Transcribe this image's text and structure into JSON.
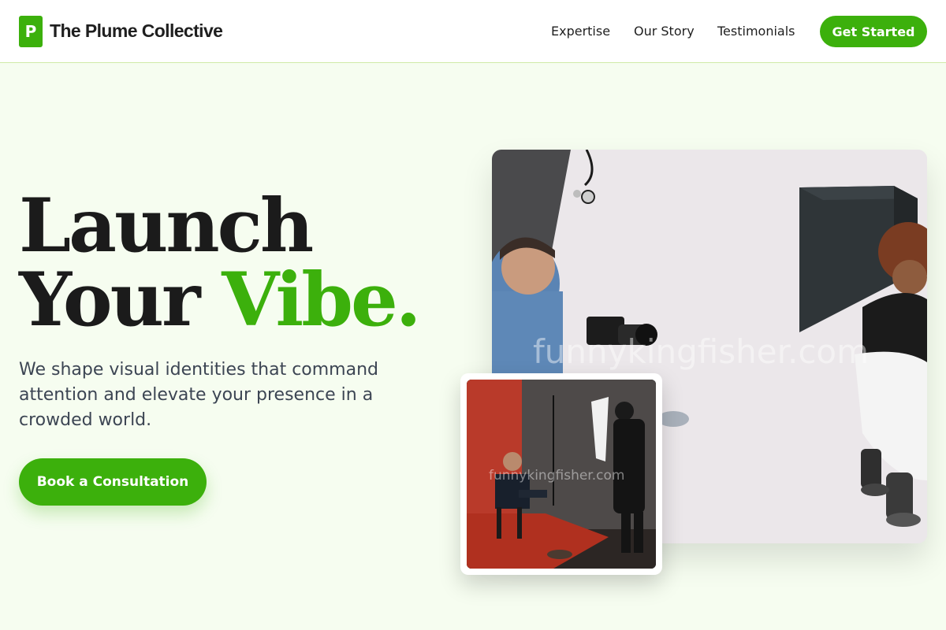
{
  "header": {
    "logo_letter": "P",
    "brand": "The Plume Collective",
    "nav": [
      {
        "label": "Expertise"
      },
      {
        "label": "Our Story"
      },
      {
        "label": "Testimonials"
      }
    ],
    "cta_label": "Get Started"
  },
  "hero": {
    "headline_line1": "Launch",
    "headline_line2_a": "Your",
    "headline_line2_b": "Vibe.",
    "subhead": "We shape visual identities that command attention and elevate your presence in a crowded world.",
    "cta_label": "Book a Consultation"
  },
  "images": {
    "main_watermark": "funnykingfisher.com",
    "inset_watermark": "funnykingfisher.com"
  },
  "colors": {
    "accent": "#3cb00c",
    "page_bg": "#f6fdf0",
    "text_dark": "#1b1b1b",
    "text_muted": "#3c4553"
  }
}
